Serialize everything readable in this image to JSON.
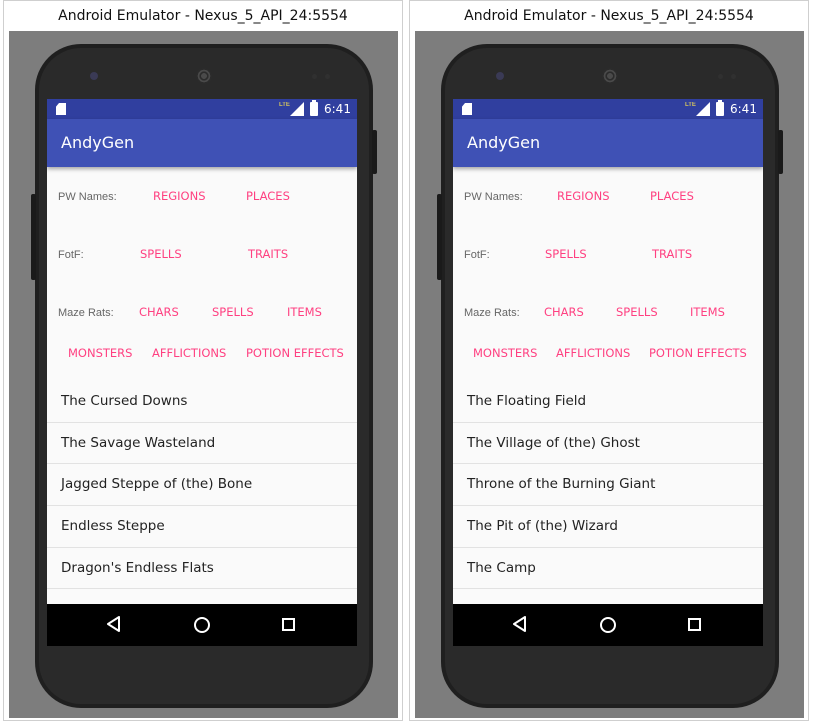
{
  "emulators": [
    {
      "window_title": "Android Emulator - Nexus_5_API_24:5554",
      "status_time": "6:41",
      "lte": "LTE",
      "app_title": "AndyGen",
      "rows": {
        "pw": {
          "label": "PW Names:",
          "buttons": [
            "REGIONS",
            "PLACES"
          ]
        },
        "fotf": {
          "label": "FotF:",
          "buttons": [
            "SPELLS",
            "TRAITS"
          ]
        },
        "maze": {
          "label": "Maze Rats:",
          "buttons": [
            "CHARS",
            "SPELLS",
            "ITEMS"
          ]
        },
        "extra": {
          "buttons": [
            "MONSTERS",
            "AFFLICTIONS",
            "POTION EFFECTS"
          ]
        }
      },
      "results": [
        "The Cursed Downs",
        "The Savage Wasteland",
        "Jagged Steppe of (the) Bone",
        "Endless Steppe",
        "Dragon's Endless Flats"
      ]
    },
    {
      "window_title": "Android Emulator - Nexus_5_API_24:5554",
      "status_time": "6:41",
      "lte": "LTE",
      "app_title": "AndyGen",
      "rows": {
        "pw": {
          "label": "PW Names:",
          "buttons": [
            "REGIONS",
            "PLACES"
          ]
        },
        "fotf": {
          "label": "FotF:",
          "buttons": [
            "SPELLS",
            "TRAITS"
          ]
        },
        "maze": {
          "label": "Maze Rats:",
          "buttons": [
            "CHARS",
            "SPELLS",
            "ITEMS"
          ]
        },
        "extra": {
          "buttons": [
            "MONSTERS",
            "AFFLICTIONS",
            "POTION EFFECTS"
          ]
        }
      },
      "results": [
        "The Floating Field",
        "The Village of (the) Ghost",
        "Throne of the Burning Giant",
        "The Pit of (the) Wizard",
        "The Camp"
      ]
    }
  ],
  "colors": {
    "status_bar": "#303f9f",
    "app_bar": "#3f51b5",
    "accent": "#ff4081",
    "emulator_backdrop": "#7d7d7d"
  },
  "icons": {
    "nav_back": "back-triangle-icon",
    "nav_home": "home-circle-icon",
    "nav_recents": "recents-square-icon"
  }
}
